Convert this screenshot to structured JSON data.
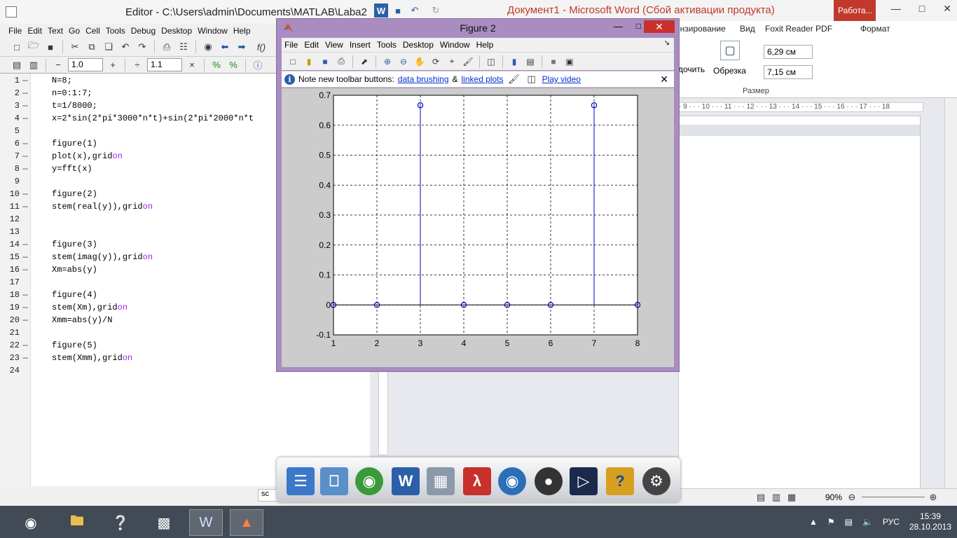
{
  "editor": {
    "title": "Editor - C:\\Users\\admin\\Documents\\MATLAB\\Laba2",
    "menu": [
      "File",
      "Edit",
      "Text",
      "Go",
      "Cell",
      "Tools",
      "Debug",
      "Desktop",
      "Window",
      "Help"
    ],
    "toolbar": {
      "cell_minus": "1.0",
      "cell_div": "1.1",
      "func_label": "f()"
    },
    "status_text": "sc",
    "code": [
      {
        "n": "1",
        "dash": "—",
        "text": "N=8;"
      },
      {
        "n": "2",
        "dash": "—",
        "text": "n=0:1:7;"
      },
      {
        "n": "3",
        "dash": "—",
        "text": "t=1/8000;"
      },
      {
        "n": "4",
        "dash": "—",
        "text": "x=2*sin(2*pi*3000*n*t)+sin(2*pi*2000*n*t"
      },
      {
        "n": "5",
        "dash": "",
        "text": ""
      },
      {
        "n": "6",
        "dash": "—",
        "text": "figure(1)"
      },
      {
        "n": "7",
        "dash": "—",
        "text": "plot(x),grid ",
        "kw": "on"
      },
      {
        "n": "8",
        "dash": "—",
        "text": "y=fft(x)"
      },
      {
        "n": "9",
        "dash": "",
        "text": ""
      },
      {
        "n": "10",
        "dash": "—",
        "text": "figure(2)"
      },
      {
        "n": "11",
        "dash": "—",
        "text": "stem(real(y)),grid ",
        "kw": "on"
      },
      {
        "n": "12",
        "dash": "",
        "text": ""
      },
      {
        "n": "13",
        "dash": "",
        "text": ""
      },
      {
        "n": "14",
        "dash": "—",
        "text": "figure(3)"
      },
      {
        "n": "15",
        "dash": "—",
        "text": "stem(imag(y)),grid ",
        "kw": "on"
      },
      {
        "n": "16",
        "dash": "—",
        "text": "Xm=abs(y)"
      },
      {
        "n": "17",
        "dash": "",
        "text": ""
      },
      {
        "n": "18",
        "dash": "—",
        "text": "figure(4)"
      },
      {
        "n": "19",
        "dash": "—",
        "text": "stem(Xm),grid ",
        "kw": "on"
      },
      {
        "n": "20",
        "dash": "—",
        "text": "Xmm=abs(y)/N"
      },
      {
        "n": "21",
        "dash": "",
        "text": ""
      },
      {
        "n": "22",
        "dash": "—",
        "text": "figure(5)"
      },
      {
        "n": "23",
        "dash": "—",
        "text": "stem(Xmm),grid ",
        "kw": "on"
      },
      {
        "n": "24",
        "dash": "",
        "text": ""
      }
    ]
  },
  "word": {
    "title": "Документ1 - Microsoft Word (Сбой активации продукта)",
    "context_tab": "Работа...",
    "tabs": [
      "ензирование",
      "Вид",
      "Foxit Reader PDF",
      "Формат"
    ],
    "ribbon": {
      "crop_label": "Обрезка",
      "group_label": "Размер",
      "height": "6,29 см",
      "width": "7,15 см",
      "partial_label": "дочить"
    },
    "ruler": "· 9 · · · 10 · · · 11 · · · 12 · · · 13 · · · 14 · · · 15 · · · 16 · · · 17 · · · 18",
    "zoom": "90%"
  },
  "figure": {
    "title": "Figure 2",
    "menu": [
      "File",
      "Edit",
      "View",
      "Insert",
      "Tools",
      "Desktop",
      "Window",
      "Help"
    ],
    "note": {
      "text": "Note new toolbar buttons:",
      "link1": "data brushing",
      "amp": "&",
      "link2": "linked plots",
      "video": "Play video"
    }
  },
  "chart_data": {
    "type": "stem",
    "x": [
      1,
      2,
      3,
      4,
      5,
      6,
      7,
      8
    ],
    "values": [
      0,
      0,
      0.6667,
      0,
      0,
      0,
      0.6667,
      0
    ],
    "xlim": [
      1,
      8
    ],
    "ylim": [
      -0.1,
      0.7
    ],
    "xticks": [
      "1",
      "2",
      "3",
      "4",
      "5",
      "6",
      "7",
      "8"
    ],
    "yticks": [
      "-0.1",
      "0",
      "0.1",
      "0.2",
      "0.3",
      "0.4",
      "0.5",
      "0.6",
      "0.7"
    ],
    "grid": true,
    "series_color": "#0000cc"
  },
  "taskbar": {
    "lang": "РУС",
    "time": "15:39",
    "date": "28.10.2013"
  }
}
